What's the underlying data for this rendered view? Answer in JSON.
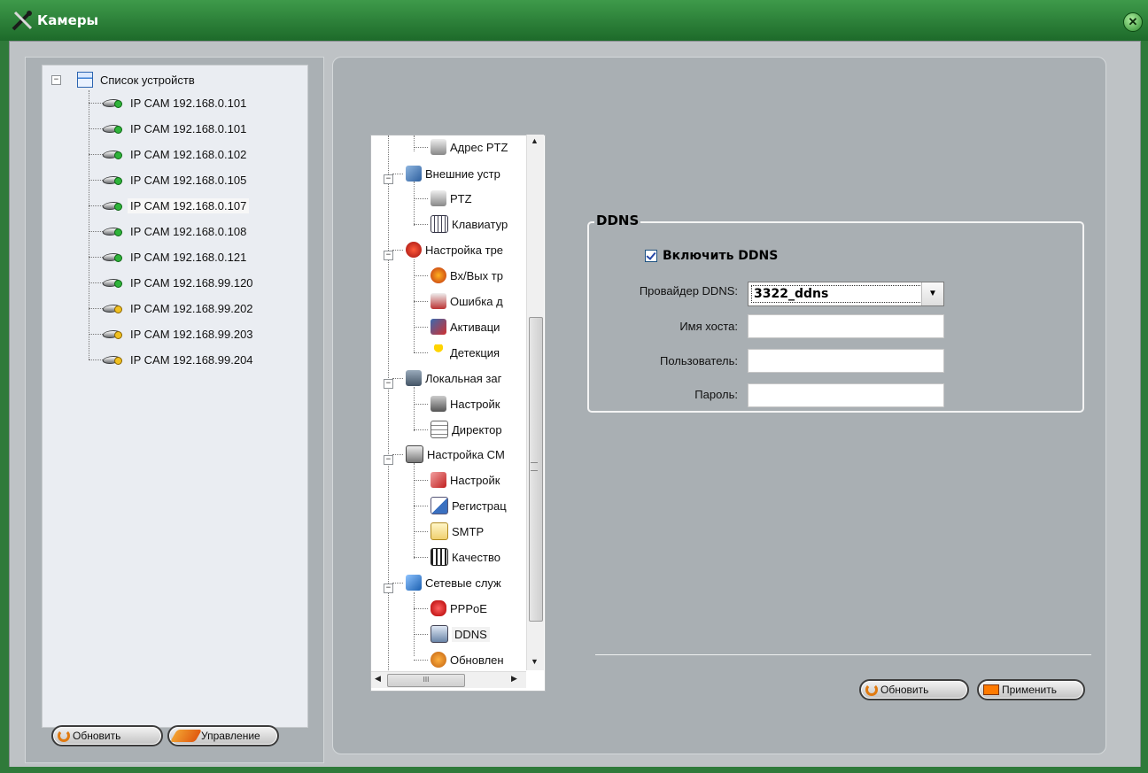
{
  "window": {
    "title": "Камеры"
  },
  "device_tree": {
    "root": "Список устройств",
    "items": [
      {
        "label": "IP CAM 192.168.0.101",
        "status": "online"
      },
      {
        "label": "IP CAM 192.168.0.101",
        "status": "online"
      },
      {
        "label": "IP CAM 192.168.0.102",
        "status": "online"
      },
      {
        "label": "IP CAM 192.168.0.105",
        "status": "online"
      },
      {
        "label": "IP CAM 192.168.0.107",
        "status": "online",
        "selected": true
      },
      {
        "label": "IP CAM 192.168.0.108",
        "status": "online"
      },
      {
        "label": "IP CAM 192.168.0.121",
        "status": "online"
      },
      {
        "label": "IP CAM 192.168.99.120",
        "status": "online"
      },
      {
        "label": "IP CAM 192.168.99.202",
        "status": "unknown"
      },
      {
        "label": "IP CAM 192.168.99.203",
        "status": "unknown"
      },
      {
        "label": "IP CAM 192.168.99.204",
        "status": "unknown"
      }
    ]
  },
  "left_buttons": {
    "refresh": "Обновить",
    "manage": "Управление"
  },
  "settings_tree": {
    "items": [
      {
        "label": "Адрес PTZ",
        "icon": "ptz-address-icon"
      },
      {
        "label": "Внешние устр",
        "icon": "external-devices-icon"
      },
      {
        "label": "PTZ",
        "icon": "ptz-icon"
      },
      {
        "label": "Клавиатур",
        "icon": "keyboard-icon"
      },
      {
        "label": "Настройка тре",
        "icon": "alarm-settings-icon"
      },
      {
        "label": "Вх/Вых тр",
        "icon": "io-alarm-icon"
      },
      {
        "label": "Ошибка д",
        "icon": "disk-error-icon"
      },
      {
        "label": "Активаци",
        "icon": "activation-icon"
      },
      {
        "label": "Детекция",
        "icon": "motion-detection-icon"
      },
      {
        "label": "Локальная заг",
        "icon": "local-storage-icon"
      },
      {
        "label": "Настройк",
        "icon": "storage-settings-icon"
      },
      {
        "label": "Директор",
        "icon": "directory-icon"
      },
      {
        "label": "Настройка CM",
        "icon": "cms-settings-icon"
      },
      {
        "label": "Настройк",
        "icon": "cms-config-icon"
      },
      {
        "label": "Регистрац",
        "icon": "registration-icon"
      },
      {
        "label": "SMTP",
        "icon": "email-icon"
      },
      {
        "label": "Качество",
        "icon": "quality-icon"
      },
      {
        "label": "Сетевые служ",
        "icon": "network-services-icon"
      },
      {
        "label": "PPPoE",
        "icon": "pppoe-icon"
      },
      {
        "label": "DDNS",
        "icon": "ddns-icon",
        "selected": true
      },
      {
        "label": "Обновлен",
        "icon": "update-icon"
      }
    ],
    "hscroll_grip": "III"
  },
  "ddns": {
    "group_title": "DDNS",
    "enable_label": "Включить DDNS",
    "enabled": true,
    "provider_label": "Провайдер DDNS:",
    "provider_value": "3322_ddns",
    "host_label": "Имя хоста:",
    "host_value": "",
    "user_label": "Пользователь:",
    "user_value": "",
    "password_label": "Пароль:",
    "password_value": ""
  },
  "right_buttons": {
    "refresh": "Обновить",
    "apply": "Применить"
  },
  "colors": {
    "title_bar": "#2f7a3a",
    "panel": "#a9afb3",
    "accent": "#e07a10"
  }
}
